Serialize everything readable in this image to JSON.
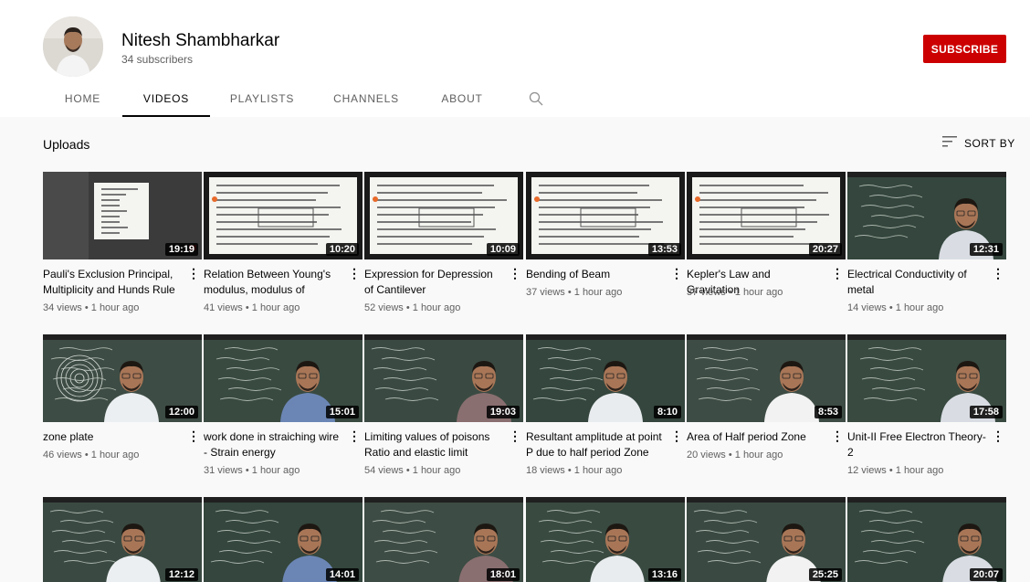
{
  "channel": {
    "name": "Nitesh Shambharkar",
    "subscribers": "34 subscribers",
    "subscribe_label": "SUBSCRIBE",
    "accent": "#cc0000"
  },
  "tabs": [
    {
      "label": "HOME"
    },
    {
      "label": "VIDEOS"
    },
    {
      "label": "PLAYLISTS"
    },
    {
      "label": "CHANNELS"
    },
    {
      "label": "ABOUT"
    }
  ],
  "search_icon": "search-icon",
  "uploads": {
    "title": "Uploads",
    "sort_label": "SORT BY",
    "sort_icon": "sort-icon"
  },
  "videos": [
    {
      "title": "Pauli's Exclusion Principal, Multiplicity and Hunds Rule",
      "duration": "19:19",
      "views": "34 views",
      "age": "1 hour ago",
      "thumb": "doc-dark"
    },
    {
      "title": "Relation Between Young's modulus, modulus of regidit...",
      "duration": "10:20",
      "views": "41 views",
      "age": "1 hour ago",
      "thumb": "doc"
    },
    {
      "title": "Expression for Depression of Cantilever",
      "duration": "10:09",
      "views": "52 views",
      "age": "1 hour ago",
      "thumb": "doc"
    },
    {
      "title": "Bending of Beam",
      "duration": "13:53",
      "views": "37 views",
      "age": "1 hour ago",
      "thumb": "doc"
    },
    {
      "title": "Kepler's Law and Gravitation",
      "duration": "20:27",
      "views": "37 views",
      "age": "1 hour ago",
      "thumb": "doc"
    },
    {
      "title": "Electrical Conductivity of metal",
      "duration": "12:31",
      "views": "14 views",
      "age": "1 hour ago",
      "thumb": "board"
    },
    {
      "title": "zone plate",
      "duration": "12:00",
      "views": "46 views",
      "age": "1 hour ago",
      "thumb": "board"
    },
    {
      "title": "work done in straiching wire - Strain energy",
      "duration": "15:01",
      "views": "31 views",
      "age": "1 hour ago",
      "thumb": "board"
    },
    {
      "title": "Limiting values of poisons Ratio and elastic limit",
      "duration": "19:03",
      "views": "54 views",
      "age": "1 hour ago",
      "thumb": "board"
    },
    {
      "title": "Resultant amplitude at point P due to half period Zone",
      "duration": "8:10",
      "views": "18 views",
      "age": "1 hour ago",
      "thumb": "board"
    },
    {
      "title": "Area of Half period Zone",
      "duration": "8:53",
      "views": "20 views",
      "age": "1 hour ago",
      "thumb": "board"
    },
    {
      "title": "Unit-II Free Electron Theory-2",
      "duration": "17:58",
      "views": "12 views",
      "age": "1 hour ago",
      "thumb": "board"
    },
    {
      "title": "",
      "duration": "12:12",
      "views": "",
      "age": "",
      "thumb": "board"
    },
    {
      "title": "",
      "duration": "14:01",
      "views": "",
      "age": "",
      "thumb": "board"
    },
    {
      "title": "",
      "duration": "18:01",
      "views": "",
      "age": "",
      "thumb": "board"
    },
    {
      "title": "",
      "duration": "13:16",
      "views": "",
      "age": "",
      "thumb": "board"
    },
    {
      "title": "",
      "duration": "25:25",
      "views": "",
      "age": "",
      "thumb": "board"
    },
    {
      "title": "",
      "duration": "20:07",
      "views": "",
      "age": "",
      "thumb": "board"
    }
  ]
}
